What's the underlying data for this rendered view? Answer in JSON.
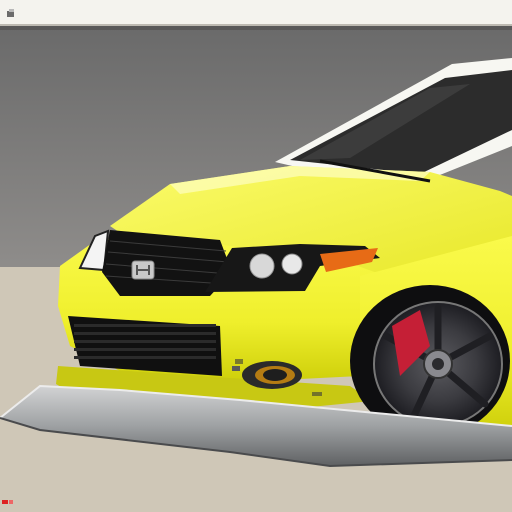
{
  "window": {
    "title": "",
    "app_icon": "app-icon"
  },
  "viewport": {
    "subject": "yellow-hatchback-car",
    "background": "studio-backdrop"
  },
  "colors": {
    "titlebar": "#f4f3ee",
    "backdrop_wall": "#7d7c7b",
    "floor": "#cfc7b7",
    "car_body": "#f2f23a",
    "car_body_shadow": "#d6d70f",
    "grille": "#151515",
    "accent_red": "#c51f36",
    "rim": "#4b4b4f",
    "platform": "#9fa1a2"
  }
}
